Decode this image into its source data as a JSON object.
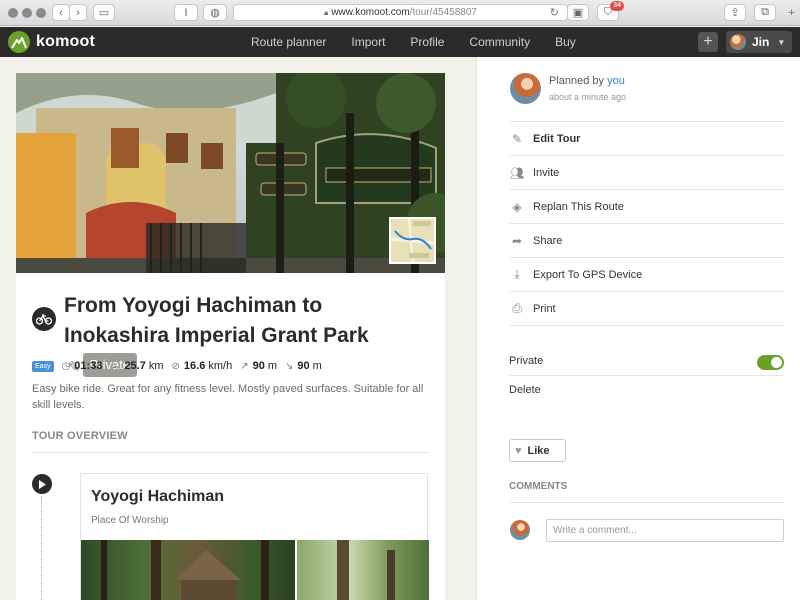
{
  "browser": {
    "url_domain": "www.komoot.com",
    "url_path": "/tour/45458807",
    "notification_count": "34",
    "reader_label": "I"
  },
  "navbar": {
    "brand": "komoot",
    "links": [
      "Route planner",
      "Import",
      "Profile",
      "Community",
      "Buy"
    ],
    "plus_label": "+",
    "user_name": "Jin"
  },
  "tour": {
    "title": "From Yoyogi Hachiman to Inokashira Imperial Grant Park",
    "privacy_pill": "Private",
    "difficulty": "Easy",
    "duration": "01:33",
    "distance": "25.7",
    "distance_unit": "km",
    "speed": "16.6",
    "speed_unit": "km/h",
    "uphill": "90",
    "uphill_unit": "m",
    "downhill": "90",
    "downhill_unit": "m",
    "description": "Easy bike ride. Great for any fitness level. Mostly paved surfaces. Suitable for all skill levels.",
    "overview_heading": "TOUR OVERVIEW"
  },
  "waypoint": {
    "title": "Yoyogi Hachiman",
    "subtitle": "Place Of Worship"
  },
  "sidebar": {
    "planned_prefix": "Planned by",
    "planned_user": "you",
    "planned_time": "about a minute ago",
    "menu": [
      {
        "label": "Edit Tour",
        "icon": "pencil-icon"
      },
      {
        "label": "Invite",
        "icon": "add-people-icon"
      },
      {
        "label": "Replan This Route",
        "icon": "directions-icon"
      },
      {
        "label": "Share",
        "icon": "share-arrow-icon"
      },
      {
        "label": "Export To GPS Device",
        "icon": "download-icon"
      },
      {
        "label": "Print",
        "icon": "printer-icon"
      }
    ],
    "private_label": "Private",
    "private_enabled": true,
    "delete_label": "Delete",
    "like_label": "Like",
    "comments_heading": "COMMENTS",
    "comment_placeholder": "Write a comment..."
  },
  "colors": {
    "brand_green": "#6aa127",
    "nav_bg": "#2b2b2b",
    "link_blue": "#3a7fc2",
    "easy_blue": "#4a90d9"
  }
}
